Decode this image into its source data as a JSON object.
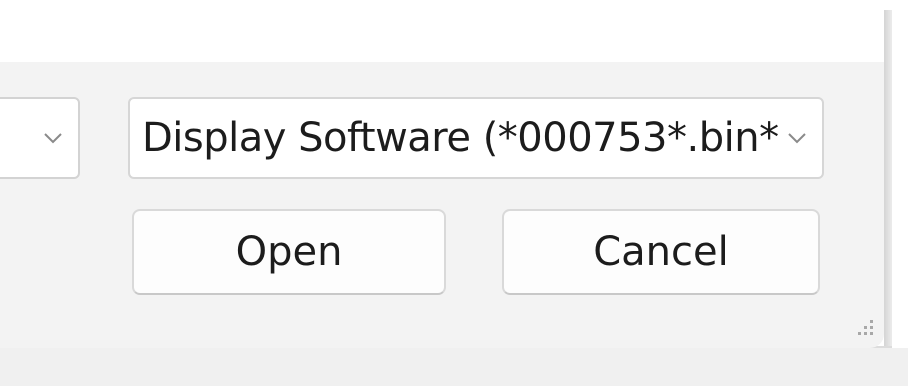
{
  "dialog": {
    "left_combo": {
      "value": "",
      "icon": "chevron-down-icon"
    },
    "file_type": {
      "value": "Display Software (*000753*.bin*",
      "icon": "chevron-down-icon"
    },
    "buttons": {
      "open_label": "Open",
      "cancel_label": "Cancel"
    },
    "resize_grip_icon": "resize-grip-icon"
  },
  "colors": {
    "dialog_bg": "#f3f3f3",
    "control_bg": "#ffffff",
    "border": "#d6d6d6",
    "text": "#1c1c1c",
    "chevron": "#8a8a8a"
  }
}
